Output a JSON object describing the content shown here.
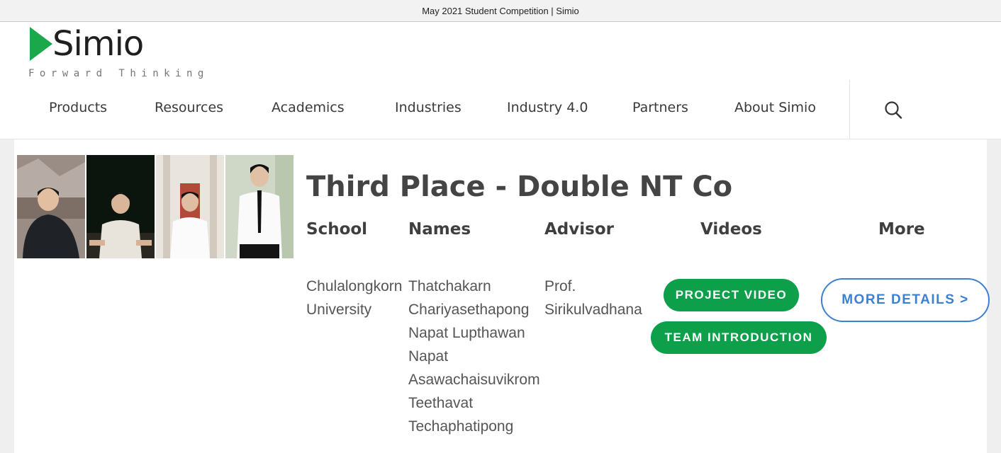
{
  "browser": {
    "tab_title": "May 2021 Student Competition | Simio"
  },
  "header": {
    "logo_word": "Simio",
    "logo_tagline": "Forward Thinking",
    "nav": [
      "Products",
      "Resources",
      "Academics",
      "Industries",
      "Industry 4.0",
      "Partners",
      "About Simio"
    ],
    "search_icon": "search-icon",
    "colors": {
      "logo_green": "#1aa84b"
    }
  },
  "entry": {
    "title": "Third Place - Double NT Co",
    "columns": {
      "school": "School",
      "names": "Names",
      "advisor": "Advisor",
      "videos": "Videos",
      "more": "More"
    },
    "school": [
      "Chulalongkorn",
      "University"
    ],
    "names": [
      "Thatchakarn",
      "Chariyasethapong",
      "Napat Lupthawan",
      "Napat",
      "Asawachaisuvikrom",
      "Teethavat",
      "Techaphatipong"
    ],
    "advisor": [
      "Prof.",
      "Sirikulvadhana"
    ],
    "buttons": {
      "project_video": "PROJECT VIDEO",
      "team_introduction": "TEAM INTRODUCTION",
      "more_details": "MORE DETAILS >"
    },
    "colors": {
      "button_green": "#0d9f4a",
      "outline_blue": "#3d7fd1"
    }
  }
}
